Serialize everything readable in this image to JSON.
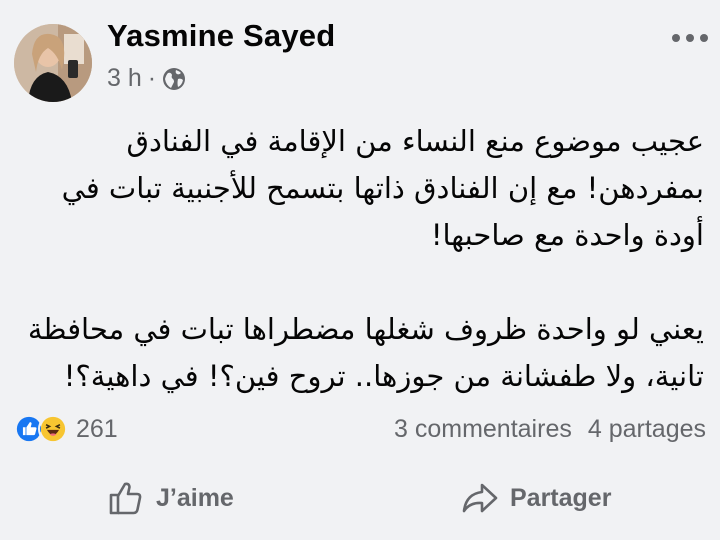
{
  "post": {
    "author": "Yasmine Sayed",
    "time": "3 h",
    "separator": "·",
    "audience_icon": "globe-icon",
    "more_icon": "more-dots-icon",
    "body": {
      "p1_lines": [
        "عجيب موضوع منع النساء من الإقامة في الفنادق",
        "بمفردهن! مع إن الفنادق ذاتها بتسمح للأجنبية تبات في",
        "أودة واحدة مع صاحبها!"
      ],
      "p2_lines": [
        "يعني لو واحدة ظروف شغلها مضطراها تبات في محافظة",
        "تانية، ولا طفشانة من جوزها.. تروح فين؟! في داهية؟!"
      ]
    },
    "reactions": {
      "icons": [
        "like-reaction-icon",
        "haha-reaction-icon"
      ],
      "count": "261"
    },
    "comments": "3 commentaires",
    "shares": "4 partages",
    "actions": {
      "like_label": "J’aime",
      "share_label": "Partager"
    },
    "colors": {
      "background": "#f1f2f4",
      "text": "#050505",
      "secondary": "#65676b",
      "like_blue": "#1877f2",
      "haha_yellow": "#f7c531"
    }
  }
}
